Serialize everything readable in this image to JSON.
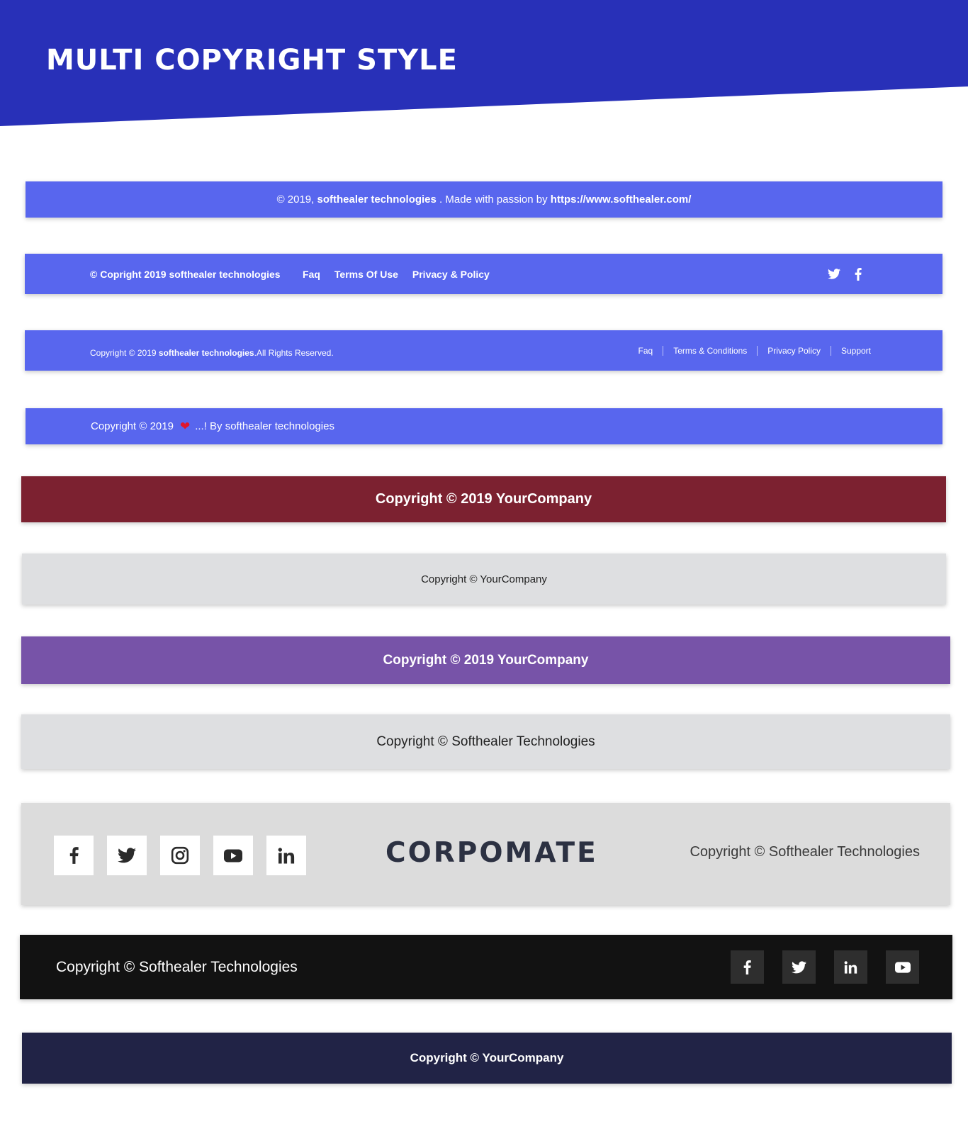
{
  "page": {
    "title": "MULTI COPYRIGHT STYLE"
  },
  "colors": {
    "hero": "#2830b8",
    "blue_bar": "#5866ee",
    "maroon": "#7c2130",
    "grey": "#dedfe1",
    "purple": "#7753a8",
    "black": "#121212",
    "navy": "#212346"
  },
  "footer1": {
    "prefix": "© 2019,",
    "company": "softhealer technologies",
    "middle": ". Made with passion by",
    "url": "https://www.softhealer.com/"
  },
  "footer2": {
    "copyright": "© Copright 2019 softhealer technologies",
    "links": [
      "Faq",
      "Terms Of Use",
      "Privacy & Policy"
    ],
    "icons": [
      "twitter-icon",
      "facebook-icon"
    ]
  },
  "footer3": {
    "prefix": "Copyright © 2019",
    "company": "softhealer technologies",
    "suffix": ".All Rights Reserved.",
    "links": [
      "Faq",
      "Terms & Conditions",
      "Privacy Policy",
      "Support"
    ]
  },
  "footer4": {
    "prefix": "Copyright © 2019",
    "heart": "❤",
    "suffix": "...! By softhealer technologies"
  },
  "footer5": {
    "text": "Copyright © 2019 YourCompany"
  },
  "footer6": {
    "text": "Copyright © YourCompany"
  },
  "footer7": {
    "text": "Copyright © 2019 YourCompany"
  },
  "footer8": {
    "text": "Copyright © Softhealer Technologies"
  },
  "footer9": {
    "icons": [
      "facebook-icon",
      "twitter-icon",
      "instagram-icon",
      "youtube-icon",
      "linkedin-icon"
    ],
    "logo": "CORPOMATE",
    "text": "Copyright © Softhealer Technologies"
  },
  "footer10": {
    "text": "Copyright © Softhealer Technologies",
    "icons": [
      "facebook-icon",
      "twitter-icon",
      "linkedin-icon",
      "youtube-icon"
    ]
  },
  "footer11": {
    "text": "Copyright © YourCompany"
  }
}
